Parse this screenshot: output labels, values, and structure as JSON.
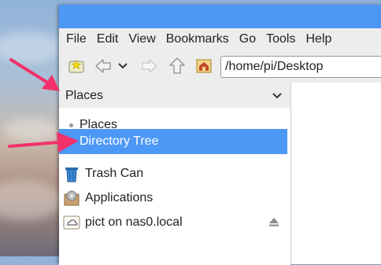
{
  "menubar": {
    "items": [
      "File",
      "Edit",
      "View",
      "Bookmarks",
      "Go",
      "Tools",
      "Help"
    ]
  },
  "toolbar": {
    "path_value": "/home/pi/Desktop",
    "icons": [
      "new-tab-icon",
      "back-icon",
      "history-dropdown-icon",
      "forward-icon",
      "up-icon",
      "home-icon"
    ]
  },
  "sidebar": {
    "header_label": "Places",
    "items": [
      {
        "label": "Places",
        "icon": "bullet-icon"
      },
      {
        "label": "Directory Tree",
        "icon": "bullet-icon",
        "selected": true
      },
      {
        "label": "Trash Can",
        "icon": "trash-icon"
      },
      {
        "label": "Applications",
        "icon": "applications-icon"
      },
      {
        "label": "pict on nas0.local",
        "icon": "network-drive-icon"
      }
    ]
  },
  "colors": {
    "accent": "#4d98f5",
    "annotation_arrow": "#f2316b"
  }
}
